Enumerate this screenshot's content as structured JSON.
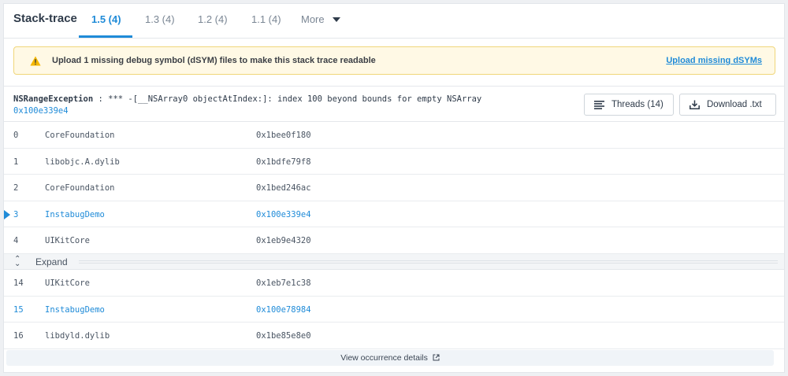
{
  "tabs": {
    "title": "Stack-trace",
    "items": [
      {
        "label": "1.5 (4)"
      },
      {
        "label": "1.3 (4)"
      },
      {
        "label": "1.2 (4)"
      },
      {
        "label": "1.1 (4)"
      },
      {
        "label": "More"
      }
    ]
  },
  "warning": {
    "text": "Upload 1 missing debug symbol (dSYM) files to make this stack trace readable",
    "link": "Upload missing dSYMs",
    "icon": "warning-triangle-icon",
    "color": "#f5b700"
  },
  "exception": {
    "name": "NSRangeException",
    "separator": " : *** -",
    "message": "[__NSArray0 objectAtIndex:]: index 100 beyond bounds for empty NSArray",
    "address": "0x100e339e4"
  },
  "buttons": {
    "threads": "Threads (14)",
    "download": "Download .txt"
  },
  "frames": [
    {
      "index": "0",
      "library": "CoreFoundation",
      "address": "0x1bee0f180"
    },
    {
      "index": "1",
      "library": "libobjc.A.dylib",
      "address": "0x1bdfe79f8"
    },
    {
      "index": "2",
      "library": "CoreFoundation",
      "address": "0x1bed246ac"
    },
    {
      "index": "3",
      "library": "InstabugDemo",
      "address": "0x100e339e4"
    },
    {
      "index": "4",
      "library": "UIKitCore",
      "address": "0x1eb9e4320"
    }
  ],
  "expand_label": "Expand",
  "frames_after": [
    {
      "index": "14",
      "library": "UIKitCore",
      "address": "0x1eb7e1c38"
    },
    {
      "index": "15",
      "library": "InstabugDemo",
      "address": "0x100e78984"
    },
    {
      "index": "16",
      "library": "libdyld.dylib",
      "address": "0x1be85e8e0"
    }
  ],
  "footer": {
    "label": "View occurrence details"
  },
  "colors": {
    "accent": "#1f8bd8",
    "warning_bg": "#fff9e5"
  }
}
